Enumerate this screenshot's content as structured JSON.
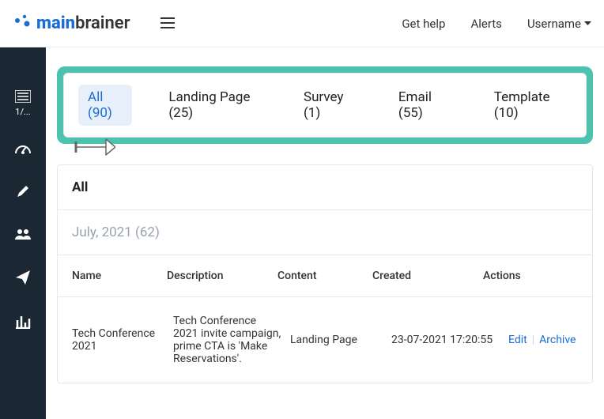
{
  "topbar": {
    "logo_pre": "main",
    "logo_post": "brainer",
    "get_help": "Get help",
    "alerts": "Alerts",
    "username": "Username"
  },
  "sidebar": {
    "first_label": "1/..."
  },
  "tabs": {
    "all": "All (90)",
    "landing": "Landing Page (25)",
    "survey": "Survey (1)",
    "email": "Email (55)",
    "template": "Template (10)"
  },
  "content": {
    "section": "All",
    "month": "July, 2021 (62)",
    "headers": {
      "name": "Name",
      "description": "Description",
      "content": "Content",
      "created": "Created",
      "actions": "Actions"
    },
    "rows": [
      {
        "name": "Tech Conference 2021",
        "description": "Tech Conference 2021 invite campaign, prime CTA is 'Make Reservations'.",
        "content": "Landing Page",
        "created": "23-07-2021 17:20:55",
        "edit": "Edit",
        "archive": "Archive"
      }
    ]
  }
}
